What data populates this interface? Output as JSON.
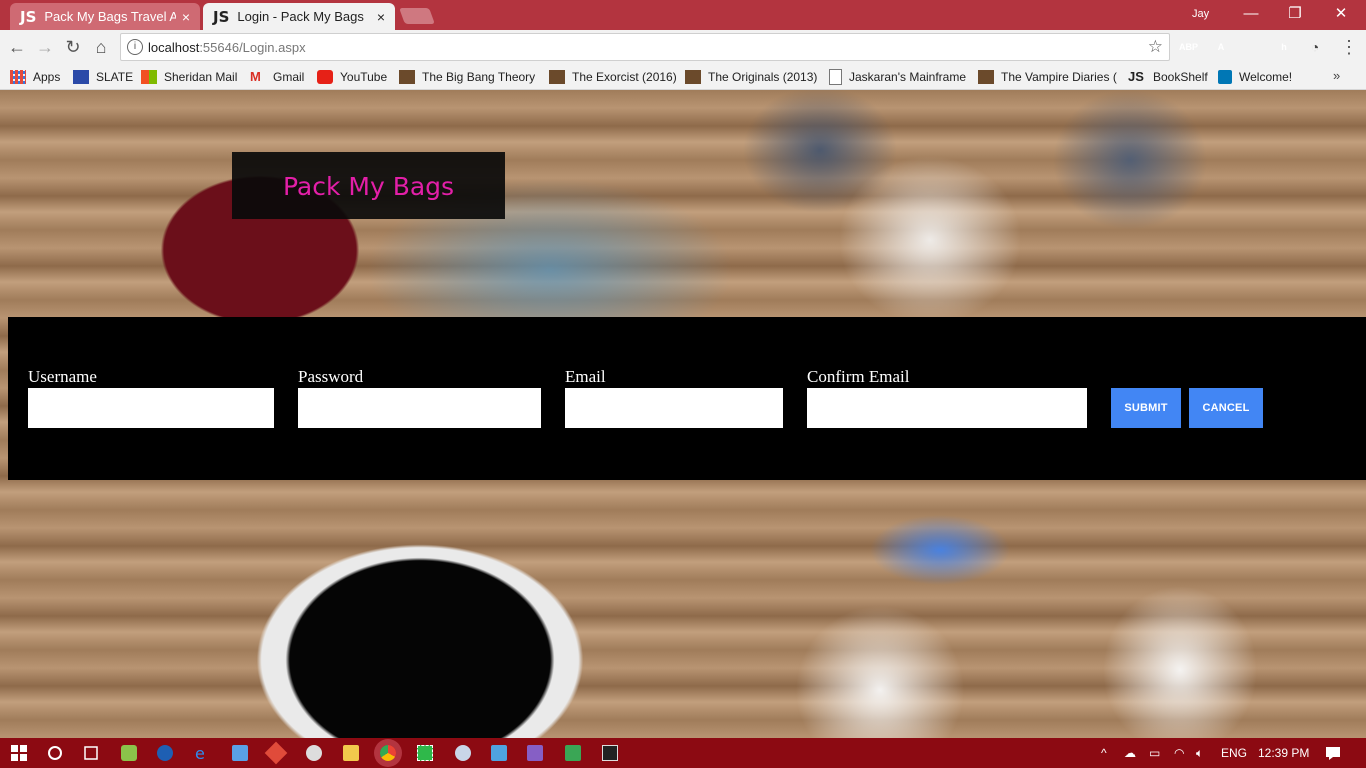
{
  "browser": {
    "tabs": [
      {
        "prefix": "JS",
        "label": "Pack My Bags Travel Age",
        "close": "×"
      },
      {
        "prefix": "JS",
        "label": "Login - Pack My Bags",
        "close": "×"
      }
    ],
    "user": "Jay",
    "window_controls": {
      "minimize": "—",
      "restore": "❐",
      "close": "✕"
    },
    "nav": {
      "back": "←",
      "forward": "→",
      "reload": "↻",
      "home": "⌂"
    },
    "url_host": "localhost",
    "url_rest": ":55646/Login.aspx",
    "info_icon": "i",
    "star": "☆",
    "extensions": [
      {
        "name": "adblock-plus-icon",
        "text": "ABP",
        "color": "#d9231d"
      },
      {
        "name": "acrobat-icon",
        "text": "A",
        "color": "#b30b00"
      },
      {
        "name": "cube-extension-icon",
        "text": "",
        "color": "#bdbdbd"
      },
      {
        "name": "puzzle-extension-icon",
        "text": "h",
        "color": "#9e9e9e"
      },
      {
        "name": "speed-extension-icon",
        "text": "◔",
        "color": "#f2f2f2"
      }
    ],
    "menu": "⋮",
    "bookmarks": [
      {
        "label": "Apps",
        "icon": "apps-grid-icon",
        "color": "#3a77e0"
      },
      {
        "label": "SLATE",
        "icon": "slate-icon",
        "color": "#2b4aa8"
      },
      {
        "label": "Sheridan Mail",
        "icon": "microsoft-icon",
        "color": "#f25022"
      },
      {
        "label": "Gmail",
        "icon": "gmail-icon",
        "color": "#d93025"
      },
      {
        "label": "YouTube",
        "icon": "youtube-icon",
        "color": "#e62117"
      },
      {
        "label": "The Big Bang Theory",
        "icon": "film-icon",
        "color": "#6b4a2b"
      },
      {
        "label": "The Exorcist (2016)",
        "icon": "film-icon",
        "color": "#6b4a2b"
      },
      {
        "label": "The Originals (2013)",
        "icon": "film-icon",
        "color": "#6b4a2b"
      },
      {
        "label": "Jaskaran's Mainframe",
        "icon": "document-icon",
        "color": "#ffffff"
      },
      {
        "label": "The Vampire Diaries (",
        "icon": "film-icon",
        "color": "#6b4a2b"
      },
      {
        "label": "BookShelf",
        "icon": "js-icon",
        "color": "#222222"
      },
      {
        "label": "Welcome!",
        "icon": "linkedin-icon",
        "color": "#0077b5"
      }
    ],
    "bookmarks_more": "»"
  },
  "page": {
    "brand": "Pack My Bags",
    "brand_color": "#e31fa8",
    "form": {
      "username_label": "Username",
      "password_label": "Password",
      "email_label": "Email",
      "confirm_email_label": "Confirm Email",
      "username_value": "",
      "password_value": "",
      "email_value": "",
      "confirm_email_value": "",
      "submit_label": "SUBMIT",
      "cancel_label": "CANCEL",
      "button_color": "#4286f4"
    }
  },
  "taskbar": {
    "language": "ENG",
    "time": "12:39 PM",
    "accent": "#8c0a12"
  }
}
